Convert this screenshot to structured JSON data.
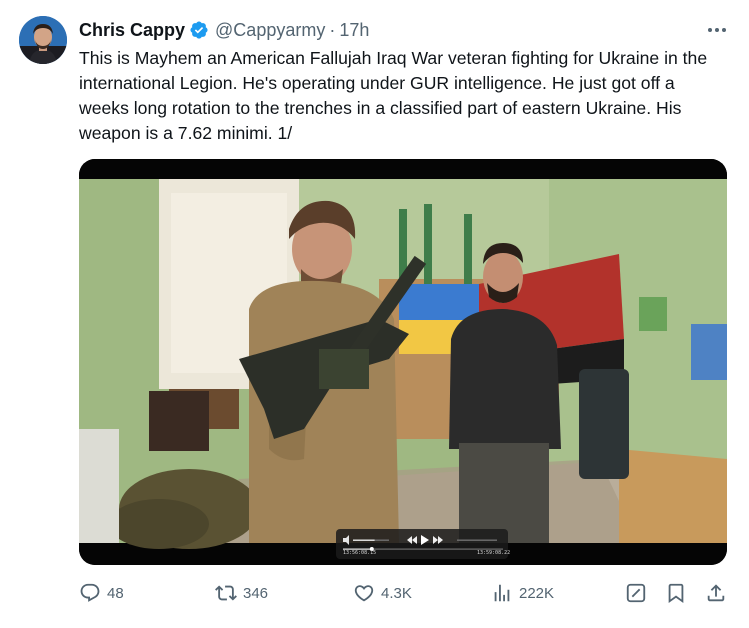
{
  "tweet": {
    "author_name": "Chris Cappy",
    "handle": "@Cappyarmy",
    "separator": "·",
    "time": "17h",
    "text": "This is Mayhem an American Fallujah Iraq War veteran fighting for Ukraine in the international Legion. He's operating under GUR intelligence. He just got off a weeks long rotation to the trenches in a classified part of eastern Ukraine. His weapon is a 7.62 minimi. 1/"
  },
  "video": {
    "current_time": "13:56:08.15",
    "end_time": "13:59:08.22",
    "progress": 0.18,
    "volume_level": 0.6
  },
  "actions": {
    "replies": "48",
    "reposts": "346",
    "likes": "4.3K",
    "views": "222K"
  },
  "colors": {
    "verified_badge": "#1d9bf0",
    "secondary_text": "#536471",
    "primary_text": "#0f1419"
  },
  "icons": {
    "more": "more-horizontal-icon",
    "reply": "reply-icon",
    "repost": "repost-icon",
    "like": "heart-icon",
    "views": "views-icon",
    "grok": "grok-icon",
    "bookmark": "bookmark-icon",
    "share": "share-icon"
  }
}
